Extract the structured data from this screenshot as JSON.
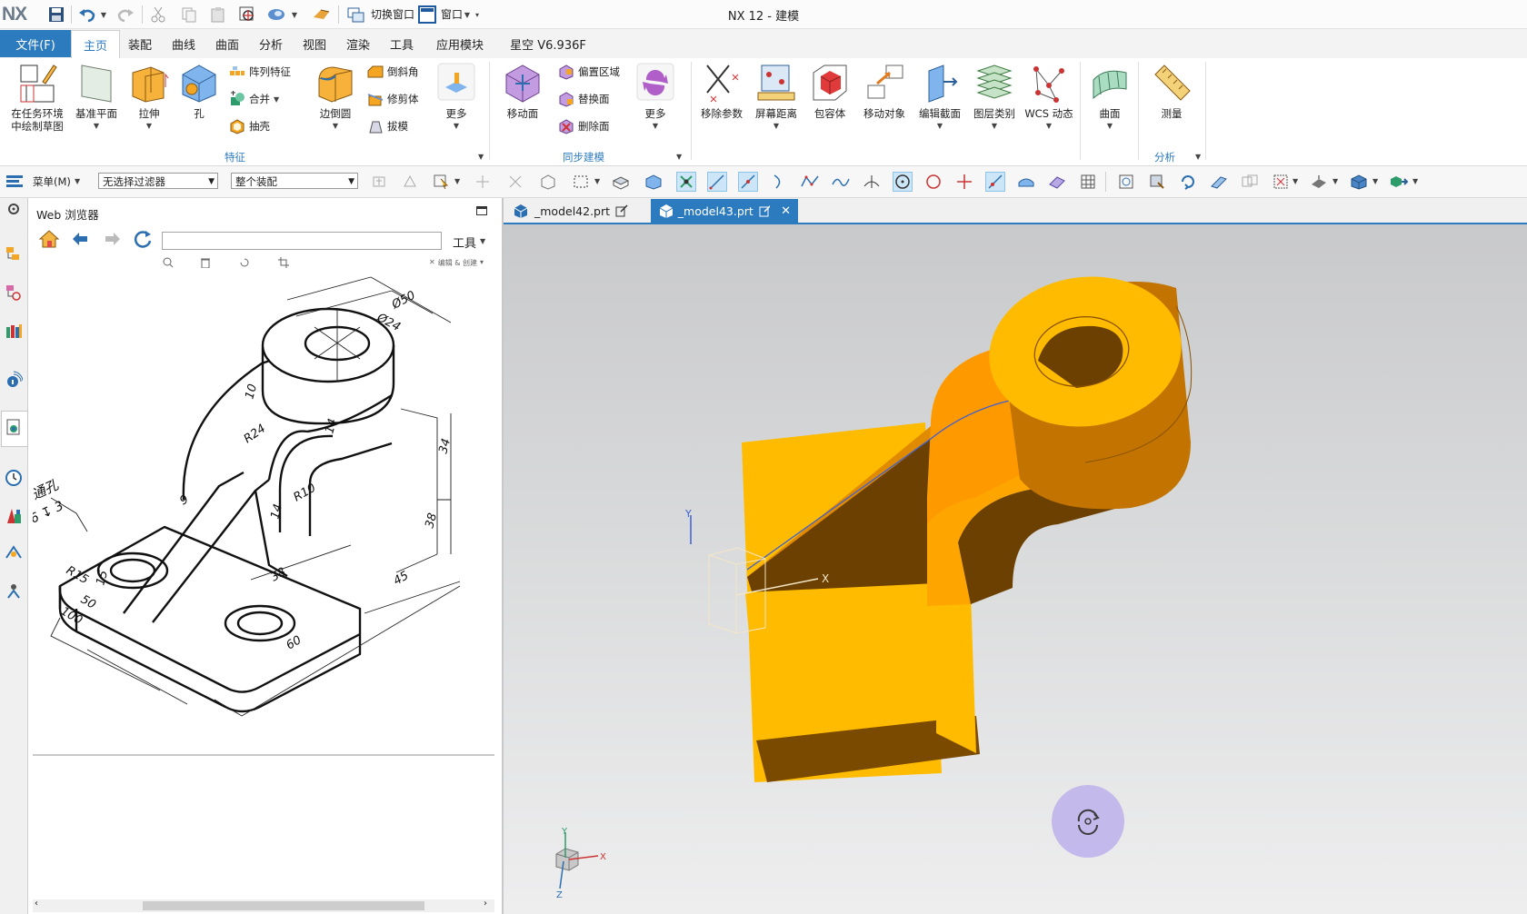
{
  "titlebar": {
    "logo": "NX",
    "app_title": "NX 12 - 建模",
    "switch_window": "切换窗口",
    "window_menu": "窗口"
  },
  "menu": {
    "file": "文件(F)",
    "tabs": [
      "主页",
      "装配",
      "曲线",
      "曲面",
      "分析",
      "视图",
      "渲染",
      "工具",
      "应用模块",
      "星空 V6.936F"
    ],
    "active_tab": "主页"
  },
  "ribbon": {
    "sketch": [
      "在任务环境",
      "中绘制草图"
    ],
    "datum_plane": "基准平面",
    "extrude": "拉伸",
    "hole": "孔",
    "pattern_feature": "阵列特征",
    "unite": "合并",
    "shell": "抽壳",
    "edge_blend": "边倒圆",
    "chamfer": "倒斜角",
    "trim_body": "修剪体",
    "draft": "拔模",
    "more1": "更多",
    "group_feature": "特征",
    "move_face": "移动面",
    "offset_region": "偏置区域",
    "replace_face": "替换面",
    "delete_face": "删除面",
    "more2": "更多",
    "group_sync": "同步建模",
    "remove_params": "移除参数",
    "screen_distance": "屏幕距离",
    "bounding_body": "包容体",
    "move_object": "移动对象",
    "edit_section": "编辑截面",
    "layer_category": "图层类别",
    "wcs_dynamic": "WCS 动态",
    "surface": "曲面",
    "measure": "测量",
    "group_analysis": "分析"
  },
  "toolbar": {
    "menu_label": "菜单(M)",
    "filter_value": "无选择过滤器",
    "scope_value": "整个装配"
  },
  "webpanel": {
    "title": "Web 浏览器",
    "address": "",
    "tools_label": "工具",
    "zoom_hint": "编辑 & 创建"
  },
  "drawing": {
    "dims": [
      "Ø50",
      "Ø24",
      "10",
      "R24",
      "14",
      "34",
      "9",
      "R10",
      "14",
      "38",
      "15",
      "50",
      "100",
      "38",
      "45",
      "60",
      "R15"
    ],
    "hole_note": [
      "通孔",
      "6 ↧ 3"
    ]
  },
  "doc_tabs": [
    {
      "name": "_model42.prt",
      "active": false
    },
    {
      "name": "_model43.prt",
      "active": true
    }
  ],
  "triad": {
    "x": "X",
    "y": "Y",
    "z": "Z"
  },
  "colors": {
    "accent": "#2c7bbf",
    "part": "#ffb800",
    "part_dark": "#b36b00",
    "fab": "#c2b7ec"
  }
}
